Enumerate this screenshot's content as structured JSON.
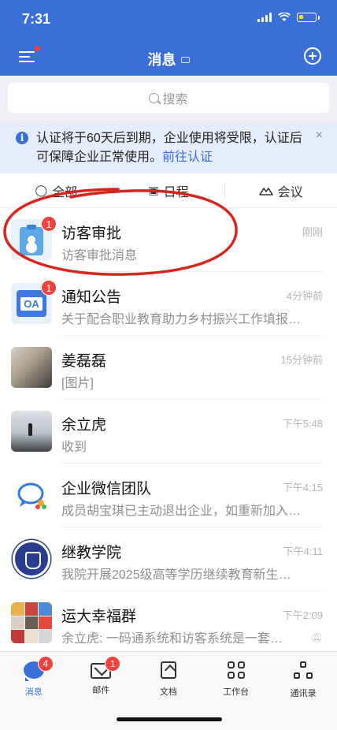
{
  "status_bar": {
    "time": "7:31"
  },
  "header": {
    "title": "消息"
  },
  "search": {
    "placeholder": "搜索"
  },
  "notice": {
    "text": "认证将于60天后到期，企业使用将受限，认证后可保障企业正常使用。",
    "link": "前往认证",
    "close": "×"
  },
  "tabs": [
    {
      "label": "全部"
    },
    {
      "label": "日程"
    },
    {
      "label": "会议"
    }
  ],
  "conversations": [
    {
      "title": "访客审批",
      "subtitle": "访客审批消息",
      "time": "刚刚",
      "badge": "1"
    },
    {
      "title": "通知公告",
      "subtitle": "关于配合职业教育助力乡村振兴工作填报…",
      "time": "4分钟前",
      "badge": "1",
      "icon_text": "OA"
    },
    {
      "title": "姜磊磊",
      "subtitle": "[图片]",
      "time": "15分钟前"
    },
    {
      "title": "余立虎",
      "subtitle": "收到",
      "time": "下午5:48"
    },
    {
      "title": "企业微信团队",
      "subtitle": "成员胡宝琪已主动退出企业，如重新加入…",
      "time": "下午4:15"
    },
    {
      "title": "继教学院",
      "subtitle": "我院开展2025级高等学历继续教育新生…",
      "time": "下午4:11"
    },
    {
      "title": "运大幸福群",
      "subtitle": "余立虎: 一码通系统和访客系统是一套…",
      "time": "下午2:09",
      "muted": true
    }
  ],
  "tabbar": [
    {
      "label": "消息",
      "badge": "4",
      "active": true
    },
    {
      "label": "邮件",
      "badge": "1"
    },
    {
      "label": "文档"
    },
    {
      "label": "工作台"
    },
    {
      "label": "通讯录"
    }
  ],
  "colors": {
    "brand": "#3a6fd8",
    "badge": "#f0413b",
    "annotation": "#d9241c",
    "notice_bg": "#e5edfb"
  }
}
